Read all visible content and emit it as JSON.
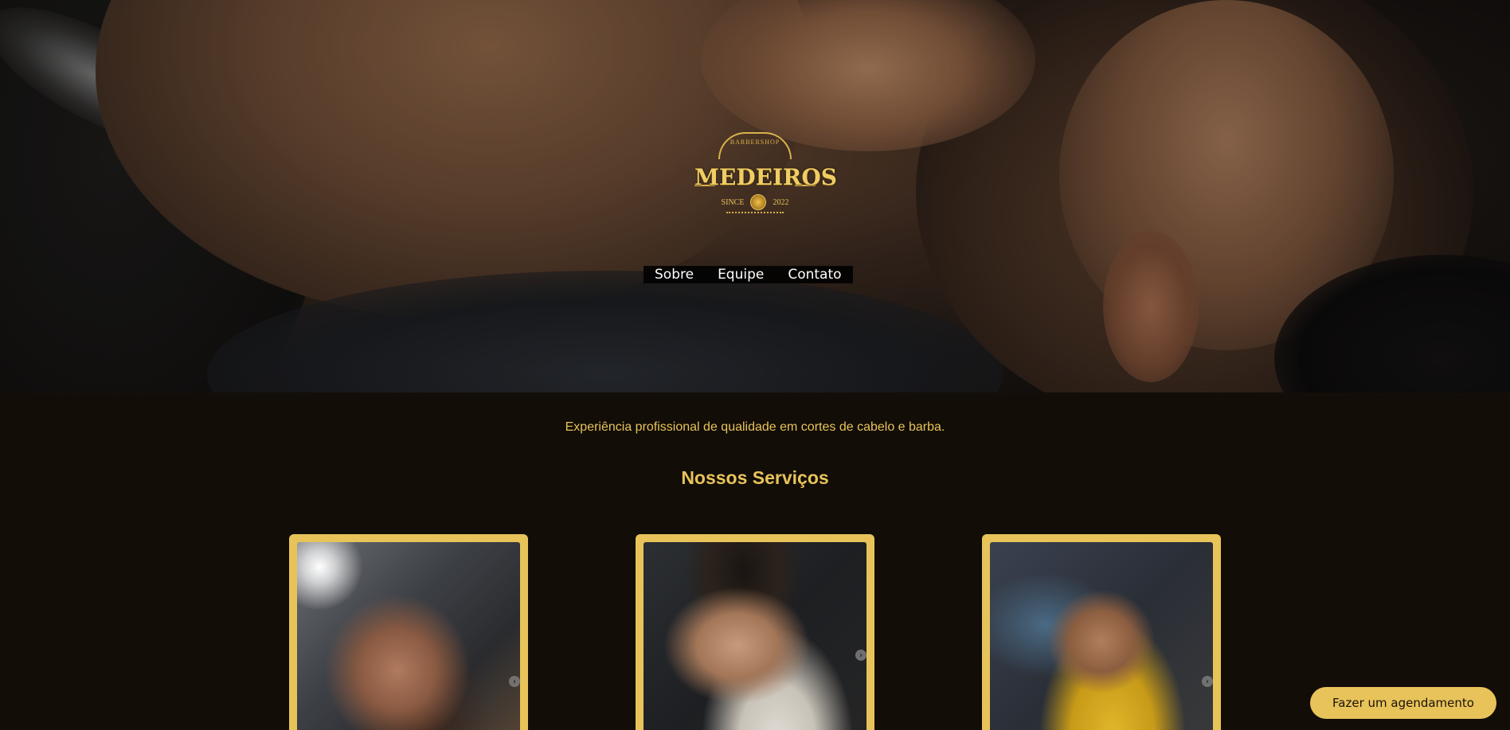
{
  "brand": {
    "top_text": "BARBERSHOP",
    "name": "MEDEIROS",
    "since_label": "SINCE",
    "since_year": "2022"
  },
  "nav": {
    "items": [
      {
        "label": "Sobre"
      },
      {
        "label": "Equipe"
      },
      {
        "label": "Contato"
      }
    ]
  },
  "main": {
    "tagline": "Experiência profissional de qualidade em cortes de cabelo e barba.",
    "services_title": "Nossos Serviços",
    "cards": [
      {
        "icon": "chevron-right-icon"
      },
      {
        "icon": "chevron-right-icon"
      },
      {
        "icon": "chevron-right-icon"
      }
    ]
  },
  "cta": {
    "label": "Fazer um agendamento"
  },
  "colors": {
    "accent": "#e8c35a",
    "background": "#1e170b",
    "nav_bg": "#000000",
    "nav_text": "#ffffff"
  }
}
